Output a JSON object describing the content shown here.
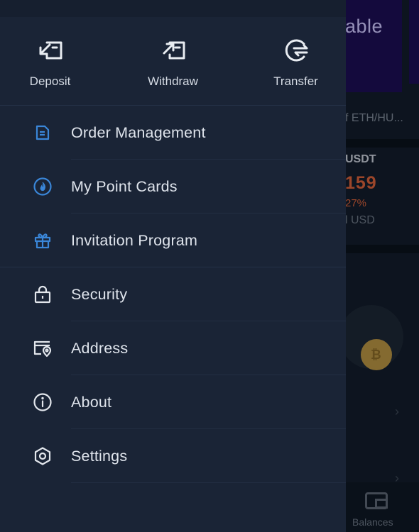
{
  "background_app": {
    "banner_text": "able",
    "pair_text": "f ETH/HU...",
    "quote_label": "USDT",
    "price": "159",
    "change": "27%",
    "usd": "l USD",
    "bottom_nav_label": "Balances",
    "colors": {
      "banner": "#1c0f55",
      "price": "#d9623b"
    }
  },
  "drawer": {
    "quick_actions": [
      {
        "label": "Deposit",
        "icon": "deposit-icon"
      },
      {
        "label": "Withdraw",
        "icon": "withdraw-icon"
      },
      {
        "label": "Transfer",
        "icon": "transfer-icon"
      }
    ],
    "menu": [
      {
        "label": "Order Management",
        "icon": "document-icon",
        "accent": true
      },
      {
        "label": "My Point Cards",
        "icon": "point-card-icon",
        "accent": true
      },
      {
        "label": "Invitation Program",
        "icon": "gift-icon",
        "accent": true
      },
      {
        "label": "Security",
        "icon": "lock-icon",
        "accent": false
      },
      {
        "label": "Address",
        "icon": "address-icon",
        "accent": false
      },
      {
        "label": "About",
        "icon": "info-icon",
        "accent": false
      },
      {
        "label": "Settings",
        "icon": "settings-icon",
        "accent": false
      }
    ],
    "colors": {
      "accent_icon": "#3a86d8",
      "plain_icon": "#e2e6ec",
      "panel": "#1a2436"
    }
  }
}
